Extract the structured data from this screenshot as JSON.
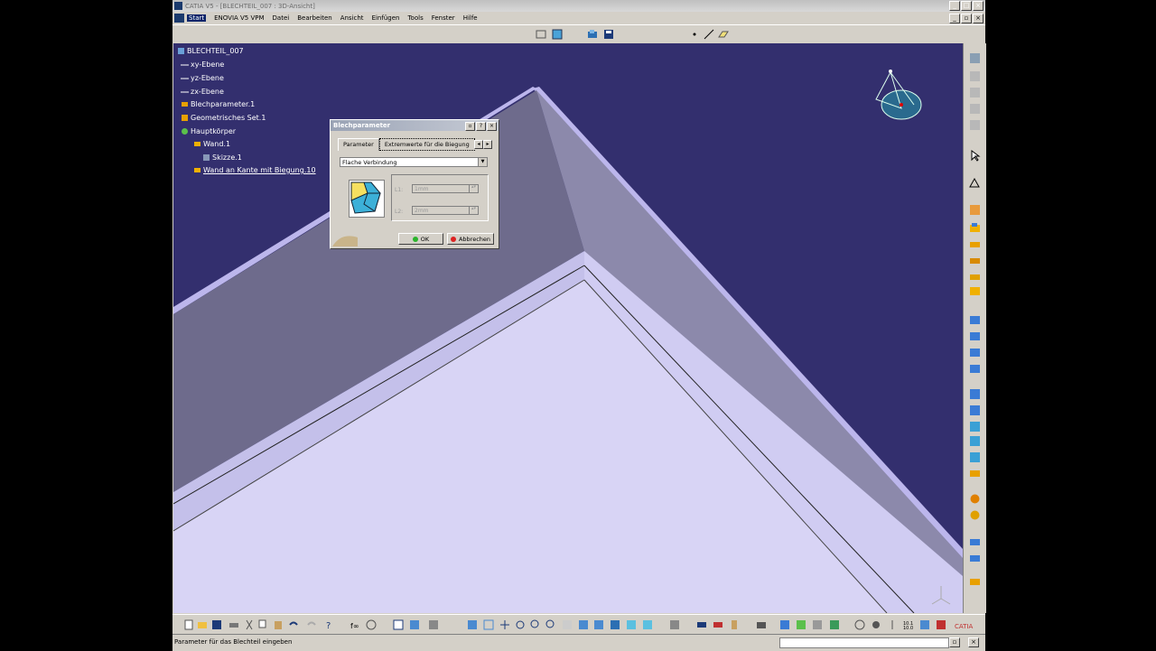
{
  "window": {
    "title": "CATIA V5 - [BLECHTEIL_007 : 3D-Ansicht]"
  },
  "menu": [
    "Start",
    "ENOVIA V5 VPM",
    "Datei",
    "Bearbeiten",
    "Ansicht",
    "Einfügen",
    "Tools",
    "Fenster",
    "Hilfe"
  ],
  "tree": {
    "root": "BLECHTEIL_007",
    "nodes": [
      {
        "label": "xy-Ebene"
      },
      {
        "label": "yz-Ebene"
      },
      {
        "label": "zx-Ebene"
      },
      {
        "label": "Blechparameter.1"
      },
      {
        "label": "Geometrisches Set.1"
      },
      {
        "label": "Hauptkörper"
      },
      {
        "label": "Wand.1"
      },
      {
        "label": "Skizze.1"
      },
      {
        "label": "Wand an Kante mit Biegung.10"
      }
    ]
  },
  "dialog": {
    "title": "Blechparameter",
    "tabs": [
      "Parameter",
      "Extremwerte für die Biegung"
    ],
    "dropdown_value": "Flache Verbindung",
    "l1_label": "L1:",
    "l1_value": "1mm",
    "l2_label": "L2:",
    "l2_value": "2mm",
    "ok_label": "OK",
    "cancel_label": "Abbrechen"
  },
  "statusbar": {
    "text": "Parameter für das Blechteil eingeben"
  },
  "colors": {
    "viewport_bg": "#332f6e",
    "wall": "#6e6b8c",
    "floor": "#d8d4f5",
    "edge": "#bcb6ec"
  }
}
